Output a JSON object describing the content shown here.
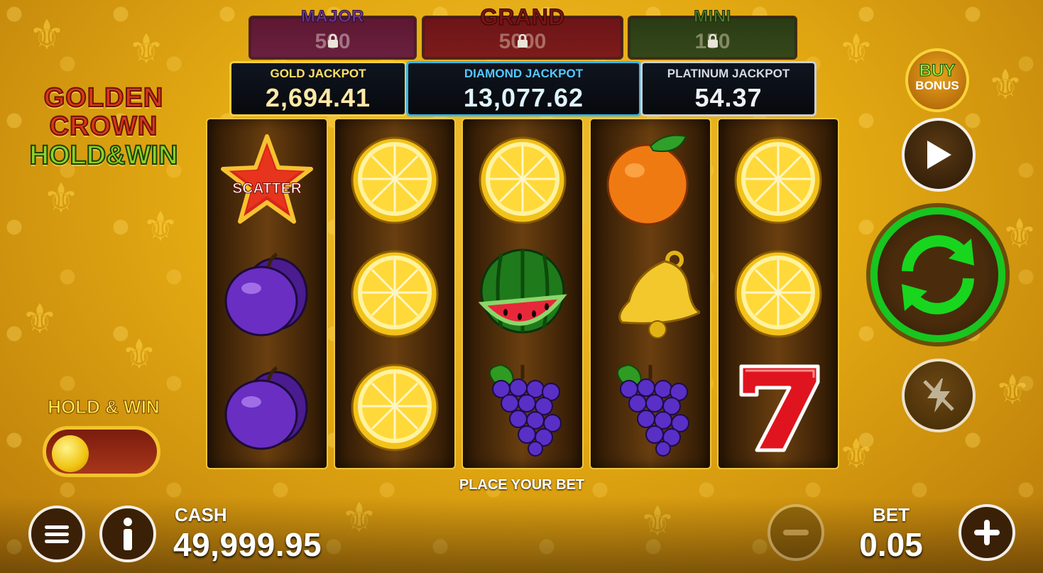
{
  "locked_jackpots": {
    "major": {
      "title": "MAJOR",
      "value": "500"
    },
    "grand": {
      "title": "GRAND",
      "value": "5000"
    },
    "mini": {
      "title": "MINI",
      "value": "150"
    }
  },
  "progressive_jackpots": {
    "gold": {
      "title": "GOLD JACKPOT",
      "value": "2,694.41"
    },
    "diamond": {
      "title": "DIAMOND JACKPOT",
      "value": "13,077.62"
    },
    "platinum": {
      "title": "PLATINUM JACKPOT",
      "value": "54.37"
    }
  },
  "logo": {
    "line1": "GOLDEN",
    "line2": "CROWN",
    "line3": "HOLD&WIN"
  },
  "reels": [
    [
      "scatter-star",
      "plum",
      "plum"
    ],
    [
      "lemon",
      "lemon",
      "lemon"
    ],
    [
      "lemon",
      "watermelon",
      "grapes"
    ],
    [
      "orange",
      "bell",
      "grapes"
    ],
    [
      "lemon",
      "lemon",
      "seven"
    ]
  ],
  "scatter_label": "SCATTER",
  "status_message": "PLACE YOUR BET",
  "buy_bonus": {
    "line1": "BUY",
    "line2": "BONUS"
  },
  "hold_and_win": {
    "label": "HOLD & WIN",
    "enabled": false
  },
  "cash": {
    "label": "CASH",
    "value": "49,999.95"
  },
  "bet": {
    "label": "BET",
    "value": "0.05"
  },
  "icons": {
    "menu": "hamburger-icon",
    "info": "info-icon",
    "minus": "minus-icon",
    "plus": "plus-icon",
    "autoplay": "play-icon",
    "spin": "spin-arrows-icon",
    "turbo": "lightning-off-icon",
    "lock": "lock-icon"
  },
  "colors": {
    "spin_green": "#17c61e",
    "gold_border": "#f3cf45",
    "diamond_border": "#35b8f0",
    "platinum_border": "#c9cfd6"
  }
}
